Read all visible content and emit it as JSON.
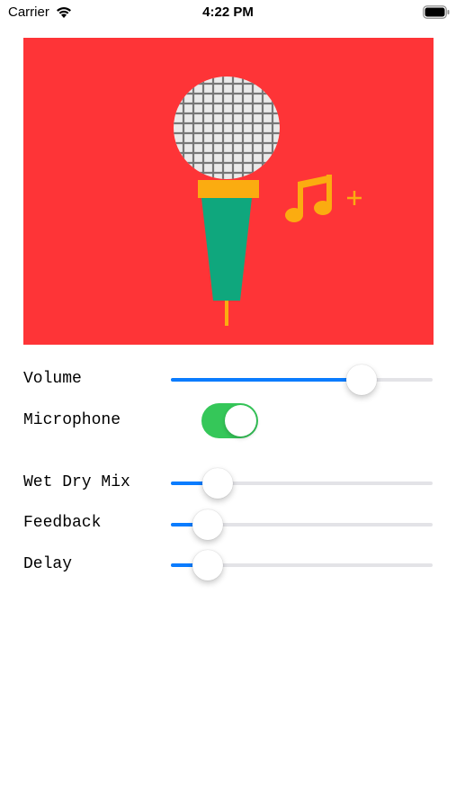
{
  "status_bar": {
    "carrier": "Carrier",
    "time": "4:22 PM",
    "icons": [
      "wifi-icon",
      "battery-icon"
    ]
  },
  "banner": {
    "background": "#fe3437",
    "illustration": [
      "microphone-icon",
      "music-note-icon",
      "plus-icon"
    ],
    "colors": {
      "mic_head": "#eaeaea",
      "mic_grid": "#777777",
      "mic_ring": "#fbac10",
      "mic_body": "#0fa77d",
      "note": "#fbac10"
    },
    "plus_symbol": "+"
  },
  "controls": {
    "volume": {
      "label": "Volume",
      "value": 0.73
    },
    "microphone": {
      "label": "Microphone",
      "on": true
    },
    "wet_dry_mix": {
      "label": "Wet Dry Mix",
      "value": 0.18
    },
    "feedback": {
      "label": "Feedback",
      "value": 0.14
    },
    "delay": {
      "label": "Delay",
      "value": 0.14
    }
  },
  "accent_colors": {
    "slider_fill": "#0a7cfe",
    "slider_track": "#e3e3e7",
    "toggle_on": "#35c759"
  }
}
